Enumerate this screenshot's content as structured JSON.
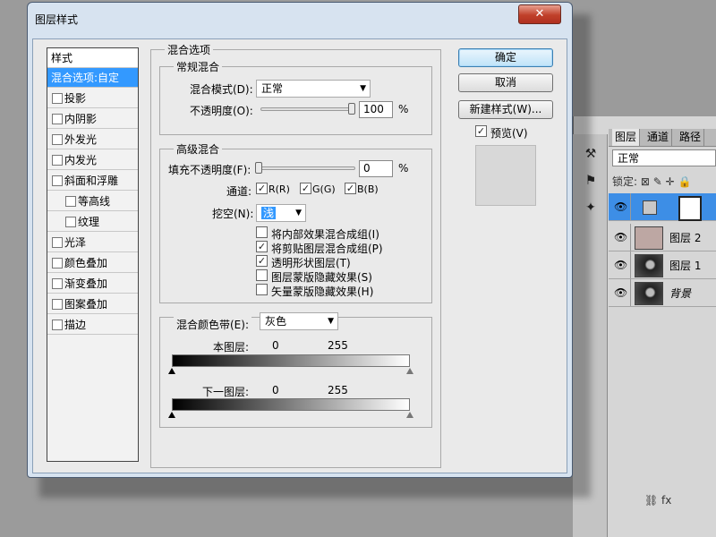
{
  "dialog": {
    "title": "图层样式",
    "close_symbol": "✕"
  },
  "style_list": {
    "header": "样式",
    "items": [
      {
        "label": "混合选项:自定",
        "checkbox": false,
        "selected": true,
        "indent": 0
      },
      {
        "label": "投影",
        "checkbox": true,
        "checked": false,
        "indent": 0
      },
      {
        "label": "内阴影",
        "checkbox": true,
        "checked": false,
        "indent": 0
      },
      {
        "label": "外发光",
        "checkbox": true,
        "checked": false,
        "indent": 0
      },
      {
        "label": "内发光",
        "checkbox": true,
        "checked": false,
        "indent": 0
      },
      {
        "label": "斜面和浮雕",
        "checkbox": true,
        "checked": false,
        "indent": 0
      },
      {
        "label": "等高线",
        "checkbox": true,
        "checked": false,
        "indent": 1
      },
      {
        "label": "纹理",
        "checkbox": true,
        "checked": false,
        "indent": 1
      },
      {
        "label": "光泽",
        "checkbox": true,
        "checked": false,
        "indent": 0
      },
      {
        "label": "颜色叠加",
        "checkbox": true,
        "checked": false,
        "indent": 0
      },
      {
        "label": "渐变叠加",
        "checkbox": true,
        "checked": false,
        "indent": 0
      },
      {
        "label": "图案叠加",
        "checkbox": true,
        "checked": false,
        "indent": 0
      },
      {
        "label": "描边",
        "checkbox": true,
        "checked": false,
        "indent": 0
      }
    ]
  },
  "blending_options": {
    "group_title": "混合选项",
    "general": {
      "title": "常规混合",
      "blend_mode_label": "混合模式(D):",
      "blend_mode_value": "正常",
      "opacity_label": "不透明度(O):",
      "opacity_value": "100",
      "opacity_fraction": 1.0,
      "opacity_unit": "%"
    },
    "advanced": {
      "title": "高级混合",
      "fill_opacity_label": "填充不透明度(F):",
      "fill_opacity_value": "0",
      "fill_opacity_fraction": 0.0,
      "fill_unit": "%",
      "channels_label": "通道:",
      "channels": [
        {
          "label": "R(R)",
          "checked": true
        },
        {
          "label": "G(G)",
          "checked": true
        },
        {
          "label": "B(B)",
          "checked": true
        }
      ],
      "knockout_label": "挖空(N):",
      "knockout_value": "浅",
      "options": [
        {
          "label": "将内部效果混合成组(I)",
          "checked": false
        },
        {
          "label": "将剪贴图层混合成组(P)",
          "checked": true
        },
        {
          "label": "透明形状图层(T)",
          "checked": true
        },
        {
          "label": "图层蒙版隐藏效果(S)",
          "checked": false
        },
        {
          "label": "矢量蒙版隐藏效果(H)",
          "checked": false
        }
      ]
    },
    "blend_if": {
      "label": "混合颜色带(E):",
      "value": "灰色",
      "this_layer_label": "本图层:",
      "this_layer_low": "0",
      "this_layer_high": "255",
      "underlying_label": "下一图层:",
      "underlying_low": "0",
      "underlying_high": "255"
    }
  },
  "buttons": {
    "ok": "确定",
    "cancel": "取消",
    "new_style": "新建样式(W)...",
    "preview_label": "预览(V)",
    "preview_checked": true,
    "check_glyph": "✓"
  },
  "layers_panel": {
    "tabs": [
      "图层",
      "通道",
      "路径"
    ],
    "blend_mode": "正常",
    "lock_label": "锁定:",
    "lock_icons": "⊠ ✎ ✛ 🔒",
    "layers": [
      {
        "name": "",
        "selected": true,
        "thumb": "blank"
      },
      {
        "name": "图层 2",
        "selected": false,
        "thumb": "brown"
      },
      {
        "name": "图层 1",
        "selected": false,
        "thumb": "photo"
      },
      {
        "name": "背景",
        "selected": false,
        "thumb": "photo",
        "italic": true
      }
    ],
    "eye_glyph": "👁",
    "bottom_icons": "⛓ fx"
  }
}
